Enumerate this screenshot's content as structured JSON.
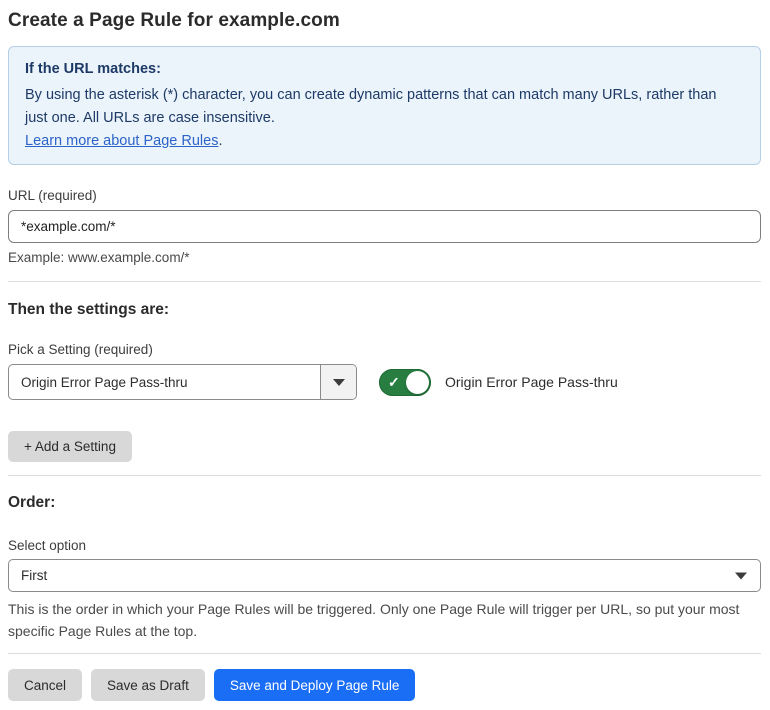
{
  "page_title": "Create a Page Rule for example.com",
  "info_box": {
    "heading": "If the URL matches:",
    "body": "By using the asterisk (*) character, you can create dynamic patterns that can match many URLs, rather than just one. All URLs are case insensitive.",
    "link_label": "Learn more about Page Rules",
    "link_suffix": "."
  },
  "url_field": {
    "label": "URL (required)",
    "value": "*example.com/*",
    "helper": "Example: www.example.com/*"
  },
  "settings_section": {
    "heading": "Then the settings are:",
    "picker_label": "Pick a Setting (required)",
    "picker_value": "Origin Error Page Pass-thru",
    "toggle_state": "on",
    "toggle_label": "Origin Error Page Pass-thru",
    "add_setting_label": "+ Add a Setting"
  },
  "order_section": {
    "heading": "Order:",
    "select_label": "Select option",
    "select_value": "First",
    "helper": "This is the order in which your Page Rules will be triggered. Only one Page Rule will trigger per URL, so put your most specific Page Rules at the top."
  },
  "actions": {
    "cancel_label": "Cancel",
    "save_draft_label": "Save as Draft",
    "save_deploy_label": "Save and Deploy Page Rule"
  },
  "icons": {
    "toggle_check": "✓"
  },
  "colors": {
    "info_background": "#ecf4fb",
    "info_border": "#b6cfe9",
    "info_text": "#1d3a66",
    "link_blue": "#2c63c9",
    "toggle_on_green": "#287d41",
    "primary_button_blue": "#1a6ef5",
    "secondary_button_gray": "#d8d8d8"
  }
}
